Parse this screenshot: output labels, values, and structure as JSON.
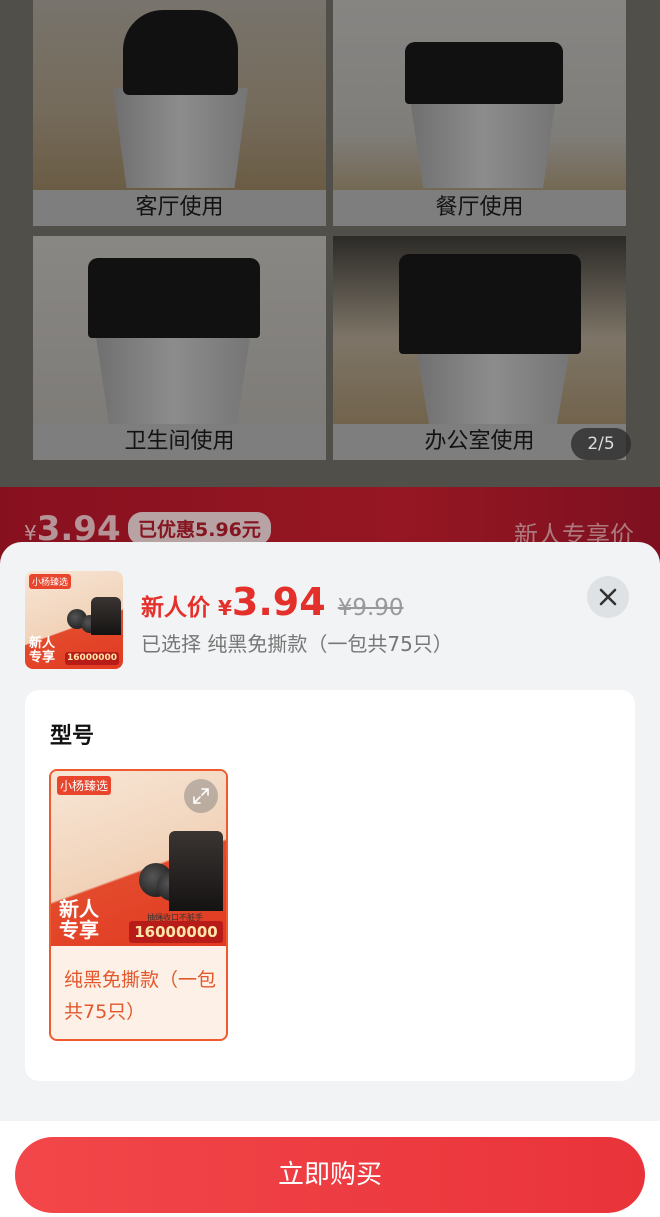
{
  "gallery": {
    "captions": [
      "客厅使用",
      "餐厅使用",
      "卫生间使用",
      "办公室使用"
    ],
    "counter": "2/5"
  },
  "banner": {
    "currency": "¥",
    "price": "3.94",
    "discount_badge": "已优惠5.96元",
    "tag": "新人专享价"
  },
  "sheet": {
    "thumbnail": {
      "logo": "小杨臻选",
      "badge_line1": "新人",
      "badge_line2": "专享",
      "sold_count": "16000000"
    },
    "price_label": "新人价",
    "currency": "¥",
    "price": "3.94",
    "original_price": "¥9.90",
    "selected_text": "已选择 纯黑免撕款（一包共75只）",
    "close_icon": "close-icon",
    "spec_section": {
      "title": "型号",
      "options": [
        {
          "label": "纯黑免撕款（一包共75只）",
          "selected": true,
          "image": {
            "logo": "小杨臻选",
            "badge_line1": "新人",
            "badge_line2": "专享",
            "caption": "抽绳收口不脏手",
            "sold_count": "16000000"
          }
        }
      ]
    },
    "buy_button": "立即购买"
  },
  "colors": {
    "accent": "#e4302b",
    "option_border": "#ef5a2f",
    "button": "#ef3f42"
  }
}
